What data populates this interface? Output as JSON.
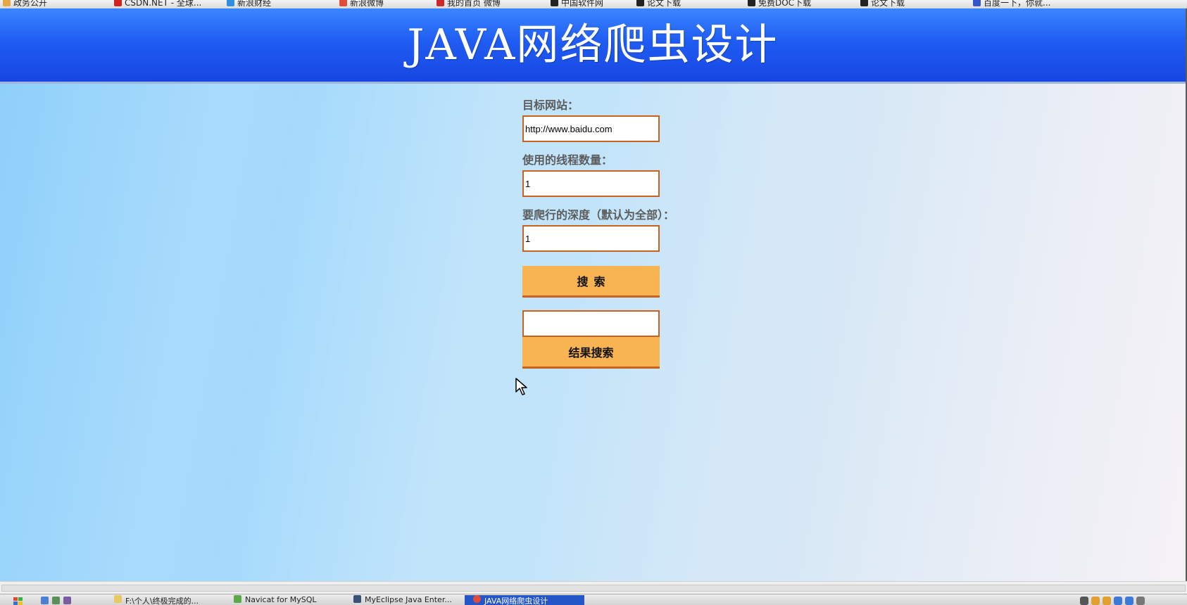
{
  "bookmarks": [
    {
      "label": "政务公开"
    },
    {
      "label": "CSDN.NET - 全球..."
    },
    {
      "label": "新浪财经"
    },
    {
      "label": "新浪微博"
    },
    {
      "label": "我的首页 微博"
    },
    {
      "label": "中国软件网"
    },
    {
      "label": "论文下载"
    },
    {
      "label": "免费DOC下载"
    },
    {
      "label": "论文下载"
    },
    {
      "label": "百度一下，你就..."
    }
  ],
  "header": {
    "title": "JAVA网络爬虫设计"
  },
  "form": {
    "target_label": "目标网站：",
    "target_value": "http://www.baidu.com",
    "threads_label": "使用的线程数量：",
    "threads_value": "1",
    "depth_label": "要爬行的深度（默认为全部）：",
    "depth_value": "1",
    "search_button": "搜索",
    "result_query_value": "",
    "result_search_button": "结果搜索"
  },
  "taskbar": {
    "items": [
      {
        "label": "F:\\个人\\终极完成的..."
      },
      {
        "label": "Navicat for MySQL"
      },
      {
        "label": "MyEclipse Java Enter..."
      },
      {
        "label": "JAVA网络爬虫设计",
        "active": true
      }
    ]
  },
  "colors": {
    "banner": "#1f5cf2",
    "button": "#f8b452",
    "border": "#c9621f"
  }
}
